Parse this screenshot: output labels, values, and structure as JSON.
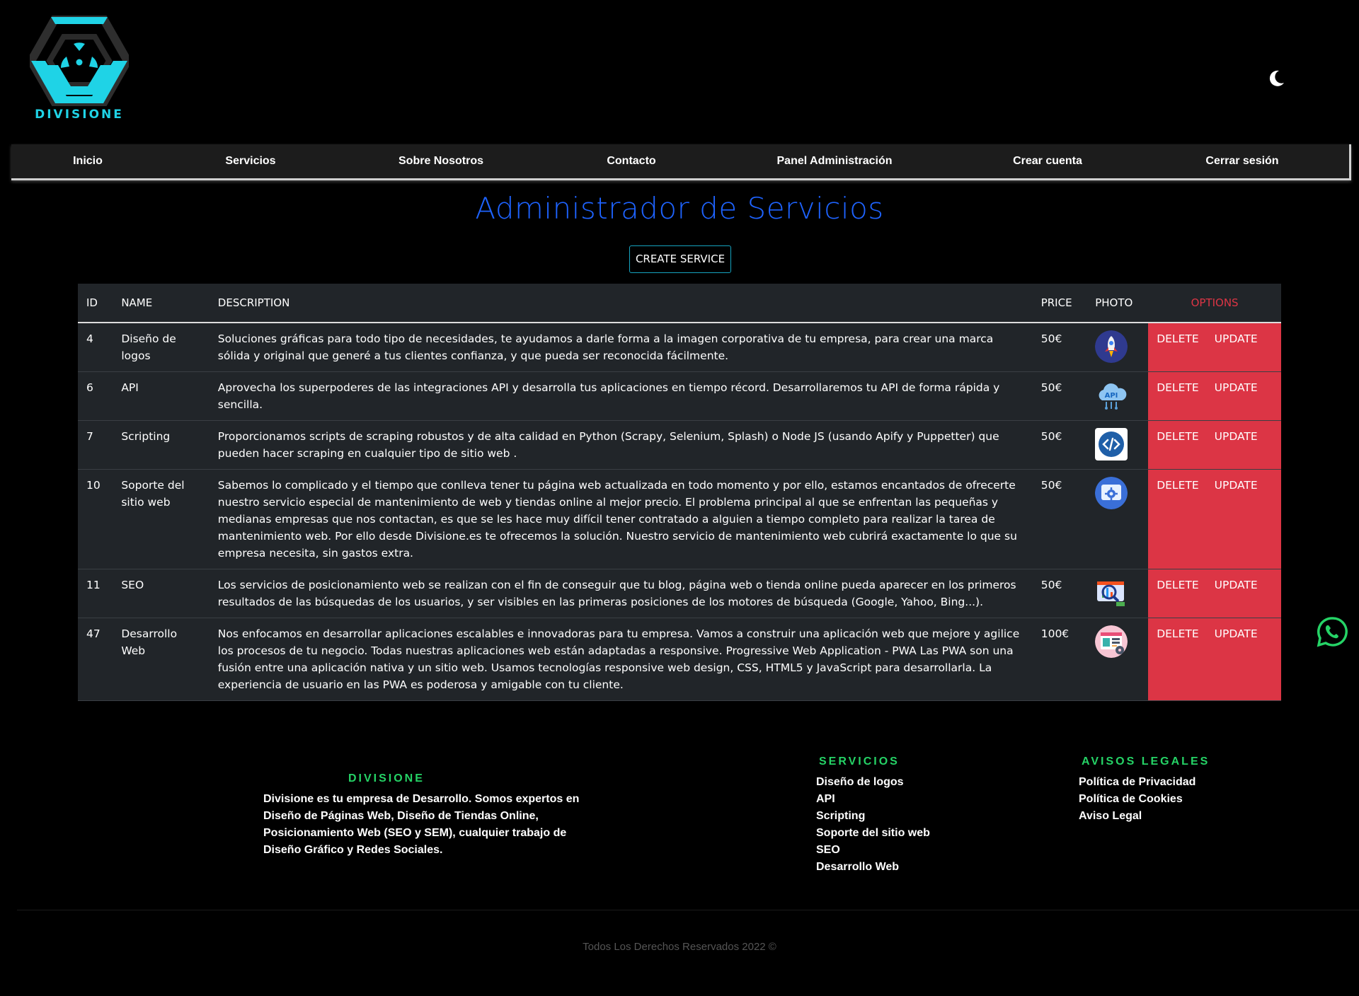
{
  "brand": {
    "name": "DIVISIONE",
    "logo_icon": "hexagon-radiation-logo",
    "accent_color": "#1fd3e6"
  },
  "header": {
    "theme_toggle_icon": "moon-icon"
  },
  "nav": {
    "items": [
      {
        "label": "Inicio"
      },
      {
        "label": "Servicios"
      },
      {
        "label": "Sobre Nosotros"
      },
      {
        "label": "Contacto"
      },
      {
        "label": "Panel Administración"
      },
      {
        "label": "Crear cuenta"
      },
      {
        "label": "Cerrar sesión"
      }
    ]
  },
  "page": {
    "title": "Administrador de Servicios",
    "create_button": "CREATE SERVICE",
    "title_color": "#1e63ff"
  },
  "table": {
    "headers": {
      "id": "ID",
      "name": "NAME",
      "description": "DESCRIPTION",
      "price": "PRICE",
      "photo": "PHOTO",
      "options": "OPTIONS"
    },
    "delete_label": "DELETE",
    "update_label": "UPDATE",
    "options_color": "#dc3545",
    "rows": [
      {
        "id": "4",
        "name": "Diseño de logos",
        "description": "Soluciones gráficas para todo tipo de necesidades, te ayudamos a darle forma a la imagen corporativa de tu empresa, para crear una marca sólida y original que generé a tus clientes confianza, y que pueda ser reconocida fácilmente.",
        "price": "50€",
        "photo_icon": "rocket-icon"
      },
      {
        "id": "6",
        "name": "API",
        "description": "Aprovecha los superpoderes de las integraciones API y desarrolla tus aplicaciones en tiempo récord. Desarrollaremos tu API de forma rápida y sencilla.",
        "price": "50€",
        "photo_icon": "api-cloud-icon",
        "photo_text": "API"
      },
      {
        "id": "7",
        "name": "Scripting",
        "description": "Proporcionamos scripts de scraping robustos y de alta calidad en Python (Scrapy, Selenium, Splash) o Node JS (usando Apify y Puppetter) que pueden hacer scraping en cualquier tipo de sitio web .",
        "price": "50€",
        "photo_icon": "code-icon"
      },
      {
        "id": "10",
        "name": "Soporte del sitio web",
        "description": "Sabemos lo complicado y el tiempo que conlleva tener tu página web actualizada en todo momento y por ello, estamos encantados de ofrecerte nuestro servicio especial de mantenimiento de web y tiendas online al mejor precio. El problema principal al que se enfrentan las pequeñas y medianas empresas que nos contactan, es que se les hace muy difícil tener contratado a alguien a tiempo completo para realizar la tarea de mantenimiento web. Por ello desde Divisione.es te ofrecemos la solución. Nuestro servicio de mantenimiento web cubrirá exactamente lo que su empresa necesita, sin gastos extra.",
        "price": "50€",
        "photo_icon": "settings-window-icon"
      },
      {
        "id": "11",
        "name": "SEO",
        "description": "Los servicios de posicionamiento web se realizan con el fin de conseguir que tu blog, página web o tienda online pueda aparecer en los primeros resultados de las búsquedas de los usuarios, y ser visibles en las primeras posiciones de los motores de búsqueda (Google, Yahoo, Bing...).",
        "price": "50€",
        "photo_icon": "seo-search-icon"
      },
      {
        "id": "47",
        "name": "Desarrollo Web",
        "description": "Nos enfocamos en desarrollar aplicaciones escalables e innovadoras para tu empresa. Vamos a construir una aplicación web que mejore y agilice los procesos de tu negocio. Todas nuestras aplicaciones web están adaptadas a responsive. Progressive Web Application - PWA Las PWA son una fusión entre una aplicación nativa y un sitio web. Usamos tecnologías responsive web design, CSS, HTML5 y JavaScript para desarrollarla. La experiencia de usuario en las PWA es poderosa y amigable con tu cliente.",
        "price": "100€",
        "photo_icon": "web-dev-icon"
      }
    ]
  },
  "footer": {
    "about": {
      "title": "DIVISIONE",
      "text_lines": [
        "Divisione es tu empresa de Desarrollo. Somos expertos en",
        "Diseño de Páginas Web, Diseño de Tiendas Online,",
        "Posicionamiento Web (SEO y SEM), cualquier trabajo de",
        "Diseño Gráfico y Redes Sociales."
      ]
    },
    "services": {
      "title": "SERVICIOS",
      "links": [
        "Diseño de logos",
        "API",
        "Scripting",
        "Soporte del sitio web",
        "SEO",
        "Desarrollo Web"
      ]
    },
    "legal": {
      "title": "AVISOS LEGALES",
      "links": [
        "Política de Privacidad",
        "Política de Cookies",
        "Aviso Legal"
      ]
    },
    "copyright": "Todos Los Derechos Reservados 2022 ©",
    "title_color": "#25d366"
  },
  "whatsapp_icon": "whatsapp-icon"
}
